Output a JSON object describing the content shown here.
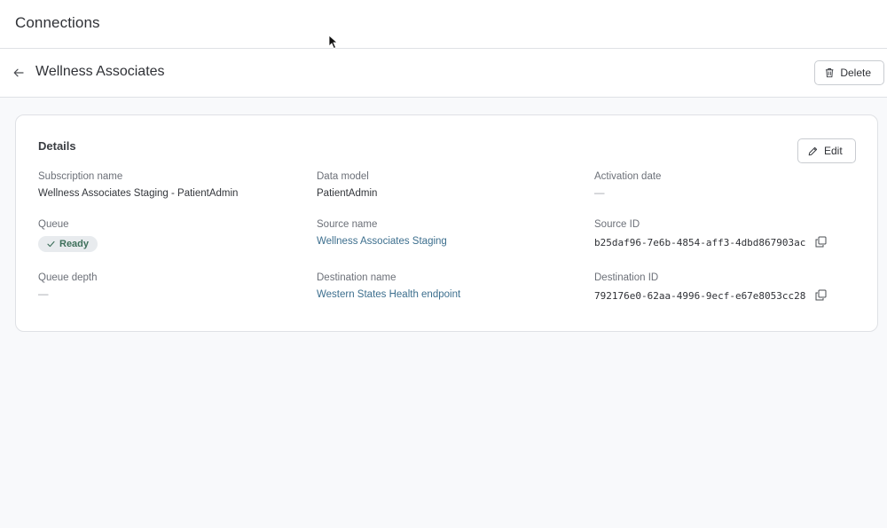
{
  "topbar": {
    "title": "Connections"
  },
  "header": {
    "title": "Wellness Associates",
    "delete_label": "Delete"
  },
  "details": {
    "title": "Details",
    "edit_label": "Edit",
    "subscription_name": {
      "label": "Subscription name",
      "value": "Wellness Associates Staging - PatientAdmin"
    },
    "data_model": {
      "label": "Data model",
      "value": "PatientAdmin"
    },
    "activation_date": {
      "label": "Activation date",
      "value": "—"
    },
    "queue": {
      "label": "Queue",
      "value": "Ready"
    },
    "source_name": {
      "label": "Source name",
      "value": "Wellness Associates Staging"
    },
    "source_id": {
      "label": "Source ID",
      "value": "b25daf96-7e6b-4854-aff3-4dbd867903ac"
    },
    "queue_depth": {
      "label": "Queue depth",
      "value": "—"
    },
    "destination_name": {
      "label": "Destination name",
      "value": "Western States Health endpoint"
    },
    "destination_id": {
      "label": "Destination ID",
      "value": "792176e0-62aa-4996-9ecf-e67e8053cc28"
    }
  },
  "icons": {
    "back": "arrow-left-icon",
    "delete": "trash-icon",
    "edit": "pencil-icon",
    "check": "check-icon",
    "copy": "copy-icon"
  },
  "colors": {
    "link": "#3d6f8e",
    "ready_badge_bg": "#e8ebee",
    "ready_badge_text": "#3d6f5a"
  }
}
